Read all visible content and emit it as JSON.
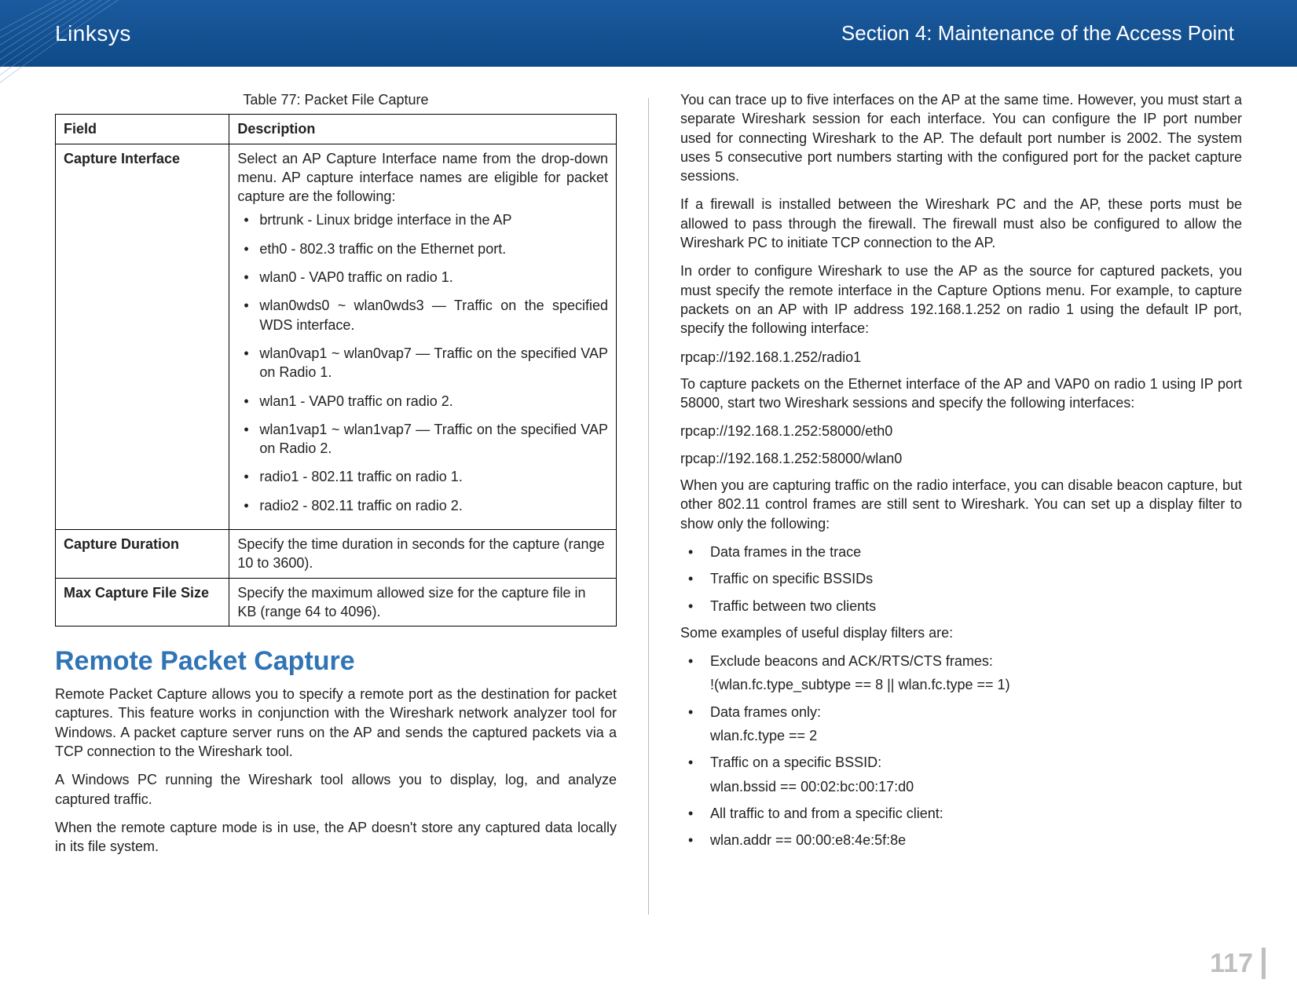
{
  "header": {
    "brand": "Linksys",
    "section": "Section 4: Maintenance of the Access Point"
  },
  "table": {
    "caption": "Table 77: Packet File Capture",
    "head_field": "Field",
    "head_desc": "Description",
    "rows": {
      "capture_interface": {
        "field": "Capture Interface",
        "intro": "Select an AP Capture Interface name from the drop-down menu. AP capture interface names are eligible for packet capture are the following:",
        "items": [
          "brtrunk - Linux bridge interface in the AP",
          "eth0 - 802.3 traffic on the Ethernet port.",
          "wlan0 - VAP0 traffic on radio 1.",
          "wlan0wds0 ~ wlan0wds3 — Traffic on the specified WDS interface.",
          "wlan0vap1 ~ wlan0vap7 — Traffic on the specified VAP on Radio 1.",
          "wlan1 - VAP0 traffic on radio 2.",
          "wlan1vap1 ~ wlan1vap7 — Traffic on the specified VAP on Radio 2.",
          "radio1 - 802.11 traffic on radio 1.",
          "radio2 - 802.11 traffic on radio 2."
        ]
      },
      "capture_duration": {
        "field": "Capture Duration",
        "desc": "Specify the time duration in seconds for the capture (range 10 to 3600)."
      },
      "max_file_size": {
        "field": "Max Capture File Size",
        "desc": "Specify the maximum allowed size for the capture file in KB (range 64 to 4096)."
      }
    }
  },
  "left": {
    "title": "Remote Packet Capture",
    "p1": "Remote Packet Capture allows you to specify a remote port as the destination for packet captures. This feature works in conjunction with the Wireshark network analyzer tool for Windows. A packet capture server runs on the AP and sends the captured packets via a TCP connection to the Wireshark tool.",
    "p2": "A Windows PC running the Wireshark tool allows you to display, log, and analyze captured traffic.",
    "p3": "When the remote capture mode is in use, the AP doesn't store any captured data locally in its file system."
  },
  "right": {
    "p1": "You can trace up to five interfaces on the AP at the same time. However, you must start a separate Wireshark session for each interface. You can configure the IP port number used for connecting Wireshark to the AP. The default port number is 2002. The system uses 5 consecutive port numbers starting with the configured port for the packet capture sessions.",
    "p2": "If a firewall is installed between the Wireshark PC and the AP, these ports must be allowed to pass through the firewall. The firewall must also be configured to allow the Wireshark PC to initiate TCP connection to the AP.",
    "p3": "In order to configure Wireshark to use the AP as the source for captured packets, you must specify the remote interface in the Capture Options menu. For example, to capture packets on an AP with IP address 192.168.1.252 on radio 1 using the default IP port, specify the following interface:",
    "ex1": "rpcap://192.168.1.252/radio1",
    "p4": "To capture packets on the Ethernet interface of the AP and VAP0 on radio 1 using IP port 58000, start two Wireshark sessions and specify the following interfaces:",
    "ex2": "rpcap://192.168.1.252:58000/eth0",
    "ex3": "rpcap://192.168.1.252:58000/wlan0",
    "p5": "When you are capturing traffic on the radio interface, you can disable beacon capture, but other 802.11 control frames are still sent to Wireshark. You can set up a display filter to show only the following:",
    "list1": [
      "Data frames in the trace",
      "Traffic on specific BSSIDs",
      "Traffic between two clients"
    ],
    "p6": "Some examples of useful display filters are:",
    "filters": [
      {
        "label": "Exclude beacons and ACK/RTS/CTS frames:",
        "code": "!(wlan.fc.type_subtype  ==  8 || wlan.fc.type == 1)"
      },
      {
        "label": "Data frames only:",
        "code": "wlan.fc.type == 2"
      },
      {
        "label": "Traffic on a specific BSSID:",
        "code": "wlan.bssid == 00:02:bc:00:17:d0"
      },
      {
        "label": "All traffic to and from a specific client:",
        "code": ""
      },
      {
        "label": "wlan.addr == 00:00:e8:4e:5f:8e",
        "code": ""
      }
    ]
  },
  "page_number": "117"
}
